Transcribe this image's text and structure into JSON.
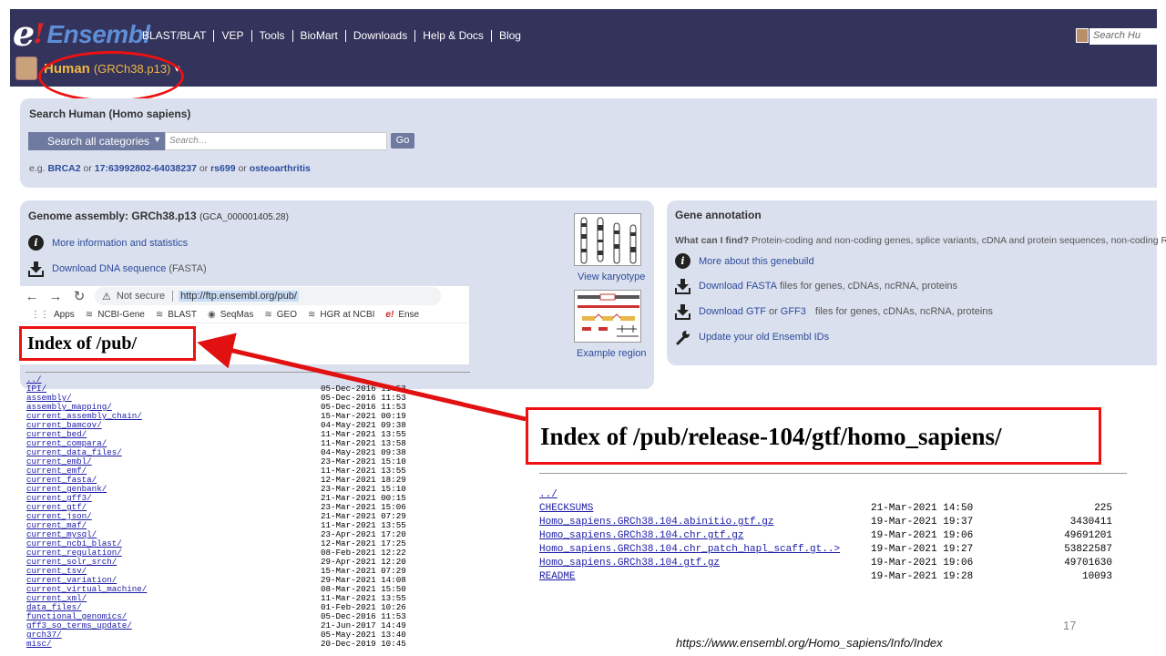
{
  "header": {
    "logo_e": "e",
    "logo_bang": "!",
    "logo_name": "Ensembl",
    "nav": [
      "BLAST/BLAT",
      "VEP",
      "Tools",
      "BioMart",
      "Downloads",
      "Help & Docs",
      "Blog"
    ],
    "search_placeholder": "Search Hu",
    "species_name": "Human",
    "species_assembly": "(GRCh38.p13)",
    "species_caret": "▾"
  },
  "search_panel": {
    "title": "Search Human (Homo sapiens)",
    "category": "Search all categories",
    "input_placeholder": "Search…",
    "go_label": "Go",
    "examples_prefix": "e.g.",
    "examples": [
      "BRCA2",
      "17:63992802-64038237",
      "rs699",
      "osteoarthritis"
    ],
    "examples_sep": [
      "or",
      "or",
      "or"
    ]
  },
  "genome_panel": {
    "title": "Genome assembly: GRCh38.p13",
    "accession": "(GCA_000001405.28)",
    "more_info": "More information and statistics",
    "download_dna": "Download DNA sequence",
    "download_dna_suffix": "(FASTA)",
    "view_karyotype": "View karyotype",
    "example_region": "Example region"
  },
  "gene_panel": {
    "title": "Gene annotation",
    "what_label": "What can I find?",
    "what_text": "Protein-coding and non-coding genes, splice variants, cDNA and protein sequences, non-coding RNAs.",
    "more_genebuild": "More about this genebuild",
    "download_fasta": "Download FASTA",
    "download_fasta_suffix": "files for genes, cDNAs, ncRNA, proteins",
    "download_gtf": "Download GTF",
    "or": "or",
    "gff3": "GFF3",
    "download_gtf_suffix": "files for genes, cDNAs, ncRNA, proteins",
    "update_ids": "Update your old Ensembl IDs"
  },
  "browser": {
    "not_secure": "Not secure",
    "url": "http://ftp.ensembl.org/pub/",
    "bookmarks": [
      "Apps",
      "NCBI-Gene",
      "BLAST",
      "SeqMas",
      "GEO",
      "HGR at NCBI",
      "Ense"
    ],
    "index_title": "Index of /pub/"
  },
  "pub_listing": [
    {
      "name": "../",
      "date": ""
    },
    {
      "name": "IPI/",
      "date": "05-Dec-2016 11:53"
    },
    {
      "name": "assembly/",
      "date": "05-Dec-2016 11:53"
    },
    {
      "name": "assembly_mapping/",
      "date": "05-Dec-2016 11:53"
    },
    {
      "name": "current_assembly_chain/",
      "date": "15-Mar-2021 00:19"
    },
    {
      "name": "current_bamcov/",
      "date": "04-May-2021 09:38"
    },
    {
      "name": "current_bed/",
      "date": "11-Mar-2021 13:55"
    },
    {
      "name": "current_compara/",
      "date": "11-Mar-2021 13:58"
    },
    {
      "name": "current_data_files/",
      "date": "04-May-2021 09:38"
    },
    {
      "name": "current_embl/",
      "date": "23-Mar-2021 15:10"
    },
    {
      "name": "current_emf/",
      "date": "11-Mar-2021 13:55"
    },
    {
      "name": "current_fasta/",
      "date": "12-Mar-2021 18:29"
    },
    {
      "name": "current_genbank/",
      "date": "23-Mar-2021 15:10"
    },
    {
      "name": "current_gff3/",
      "date": "21-Mar-2021 00:15"
    },
    {
      "name": "current_gtf/",
      "date": "23-Mar-2021 15:06"
    },
    {
      "name": "current_json/",
      "date": "21-Mar-2021 07:29"
    },
    {
      "name": "current_maf/",
      "date": "11-Mar-2021 13:55"
    },
    {
      "name": "current_mysql/",
      "date": "23-Apr-2021 17:20"
    },
    {
      "name": "current_ncbi_blast/",
      "date": "12-Mar-2021 17:25"
    },
    {
      "name": "current_regulation/",
      "date": "08-Feb-2021 12:22"
    },
    {
      "name": "current_solr_srch/",
      "date": "29-Apr-2021 12:20"
    },
    {
      "name": "current_tsv/",
      "date": "15-Mar-2021 07:29"
    },
    {
      "name": "current_variation/",
      "date": "29-Mar-2021 14:08"
    },
    {
      "name": "current_virtual_machine/",
      "date": "08-Mar-2021 15:50"
    },
    {
      "name": "current_xml/",
      "date": "11-Mar-2021 13:55"
    },
    {
      "name": "data_files/",
      "date": "01-Feb-2021 10:26"
    },
    {
      "name": "functional_genomics/",
      "date": "05-Dec-2016 11:53"
    },
    {
      "name": "gff3_so_terms_update/",
      "date": "21-Jun-2017 14:49"
    },
    {
      "name": "grch37/",
      "date": "05-May-2021 13:40"
    },
    {
      "name": "misc/",
      "date": "20-Dec-2019 10:45"
    }
  ],
  "gtf_index_title": "Index of /pub/release-104/gtf/homo_sapiens/",
  "gtf_listing": [
    {
      "name": "../",
      "date": "",
      "size": ""
    },
    {
      "name": "CHECKSUMS",
      "date": "21-Mar-2021 14:50",
      "size": "225"
    },
    {
      "name": "Homo_sapiens.GRCh38.104.abinitio.gtf.gz",
      "date": "19-Mar-2021 19:37",
      "size": "3430411"
    },
    {
      "name": "Homo_sapiens.GRCh38.104.chr.gtf.gz",
      "date": "19-Mar-2021 19:06",
      "size": "49691201"
    },
    {
      "name": "Homo_sapiens.GRCh38.104.chr_patch_hapl_scaff.gt..>",
      "date": "19-Mar-2021 19:27",
      "size": "53822587"
    },
    {
      "name": "Homo_sapiens.GRCh38.104.gtf.gz",
      "date": "19-Mar-2021 19:06",
      "size": "49701630"
    },
    {
      "name": "README",
      "date": "19-Mar-2021 19:28",
      "size": "10093"
    }
  ],
  "slide": {
    "page_number": "17",
    "source_url": "https://www.ensembl.org/Homo_sapiens/Info/Index"
  },
  "colors": {
    "header_bg": "#33335c",
    "panel_bg": "#dbe0ee",
    "link": "#2b4c9c",
    "highlight_red": "#e11111",
    "species_gold": "#f2b842"
  }
}
